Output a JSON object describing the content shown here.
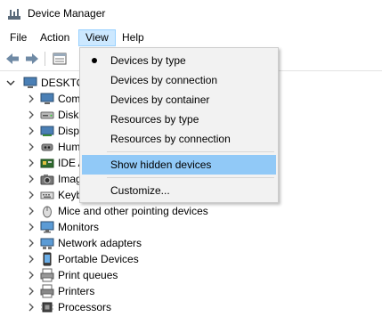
{
  "window": {
    "title": "Device Manager"
  },
  "menubar": {
    "file": "File",
    "action": "Action",
    "view": "View",
    "help": "Help"
  },
  "view_menu": {
    "items": [
      {
        "label": "Devices by type",
        "checked": true
      },
      {
        "label": "Devices by connection",
        "checked": false
      },
      {
        "label": "Devices by container",
        "checked": false
      },
      {
        "label": "Resources by type",
        "checked": false
      },
      {
        "label": "Resources by connection",
        "checked": false
      },
      {
        "label": "Show hidden devices",
        "checked": false,
        "highlighted": true
      },
      {
        "label": "Customize...",
        "checked": false
      }
    ]
  },
  "tree": {
    "root": "DESKTO",
    "items": [
      {
        "label": "Com",
        "icon": "computer-icon"
      },
      {
        "label": "Disk",
        "icon": "disk-drive-icon"
      },
      {
        "label": "Disp",
        "icon": "display-adapter-icon"
      },
      {
        "label": "Hum",
        "icon": "human-interface-icon"
      },
      {
        "label": "IDE A",
        "icon": "ide-controller-icon"
      },
      {
        "label": "Imag",
        "icon": "imaging-device-icon"
      },
      {
        "label": "Keyb",
        "icon": "keyboard-icon"
      },
      {
        "label": "Mice and other pointing devices",
        "icon": "mouse-icon"
      },
      {
        "label": "Monitors",
        "icon": "monitor-icon"
      },
      {
        "label": "Network adapters",
        "icon": "network-adapter-icon"
      },
      {
        "label": "Portable Devices",
        "icon": "portable-device-icon"
      },
      {
        "label": "Print queues",
        "icon": "print-queue-icon"
      },
      {
        "label": "Printers",
        "icon": "printer-icon"
      },
      {
        "label": "Processors",
        "icon": "processor-icon"
      }
    ]
  },
  "colors": {
    "menu_active": "#cce8ff",
    "menu_highlight": "#91c9f7",
    "dropdown_bg": "#f2f2f2"
  }
}
